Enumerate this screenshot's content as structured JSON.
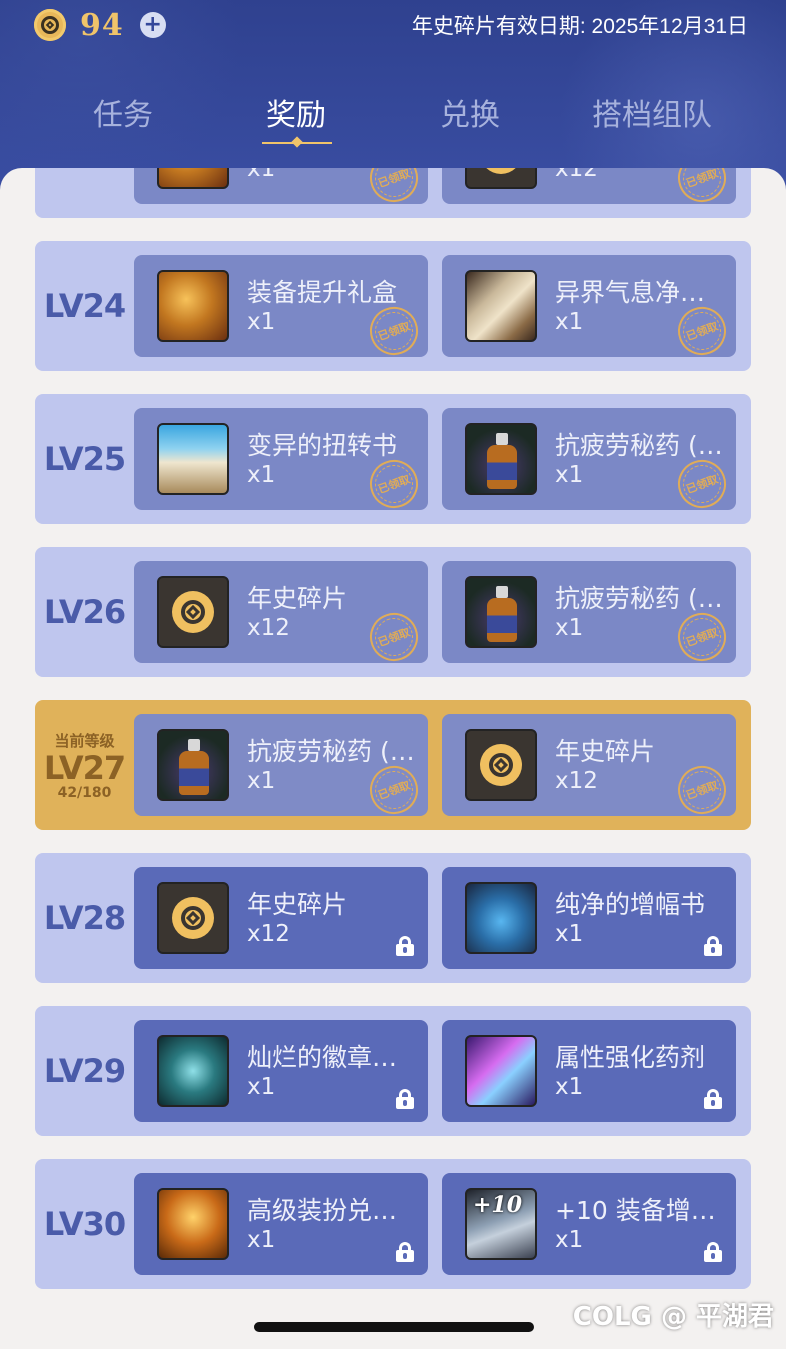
{
  "header": {
    "currency_amount": "94",
    "add_label": "+",
    "validity": "年史碎片有效日期: 2025年12月31日",
    "tabs": [
      "任务",
      "奖励",
      "兑换",
      "搭档组队"
    ],
    "active_tab": "奖励"
  },
  "stamp_text": "已领取",
  "partial_row": {
    "rewards": [
      {
        "name": "",
        "qty": "x1",
        "icon": "box-icon",
        "claimed": true
      },
      {
        "name": "",
        "qty": "x12",
        "icon": "coin-icon",
        "claimed": true
      }
    ]
  },
  "levels": [
    {
      "level": "LV24",
      "rewards": [
        {
          "name": "装备提升礼盒",
          "qty": "x1",
          "icon": "gift-box-icon",
          "claimed": true
        },
        {
          "name": "异界气息净…",
          "qty": "x1",
          "icon": "scroll-icon",
          "claimed": true
        }
      ]
    },
    {
      "level": "LV25",
      "rewards": [
        {
          "name": "变异的扭转书",
          "qty": "x1",
          "icon": "book-icon",
          "claimed": true
        },
        {
          "name": "抗疲劳秘药 (…",
          "qty": "x1",
          "icon": "potion-icon",
          "claimed": true
        }
      ]
    },
    {
      "level": "LV26",
      "rewards": [
        {
          "name": "年史碎片",
          "qty": "x12",
          "icon": "coin-icon",
          "claimed": true
        },
        {
          "name": "抗疲劳秘药 (…",
          "qty": "x1",
          "icon": "potion-icon",
          "claimed": true
        }
      ]
    },
    {
      "level": "LV27",
      "current": true,
      "current_label": "当前等级",
      "progress": "42/180",
      "rewards": [
        {
          "name": "抗疲劳秘药 (…",
          "qty": "x1",
          "icon": "potion-icon",
          "claimed": true
        },
        {
          "name": "年史碎片",
          "qty": "x12",
          "icon": "coin-icon",
          "claimed": true
        }
      ]
    },
    {
      "level": "LV28",
      "rewards": [
        {
          "name": "年史碎片",
          "qty": "x12",
          "icon": "coin-icon",
          "claimed": false
        },
        {
          "name": "纯净的增幅书",
          "qty": "x1",
          "icon": "blue-book-icon",
          "claimed": false
        }
      ]
    },
    {
      "level": "LV29",
      "rewards": [
        {
          "name": "灿烂的徽章…",
          "qty": "x1",
          "icon": "badge-icon",
          "claimed": false
        },
        {
          "name": "属性强化药剂",
          "qty": "x1",
          "icon": "elixir-icon",
          "claimed": false
        }
      ]
    },
    {
      "level": "LV30",
      "rewards": [
        {
          "name": "高级装扮兑…",
          "qty": "x1",
          "icon": "chest-icon",
          "claimed": false
        },
        {
          "name": "+10 装备增…",
          "qty": "x1",
          "icon": "plus10-icon",
          "claimed": false,
          "icon_text": "+10"
        }
      ]
    }
  ],
  "watermark": "COLG @ 平湖君",
  "colors": {
    "header_bg": "#34479a",
    "accent_gold": "#f0c46a",
    "card_bg": "#bfc6ee",
    "current_card_bg": "#e0b25a",
    "reward_locked_bg": "#5a6ab8",
    "reward_claimed_bg": "#7b88c6"
  }
}
